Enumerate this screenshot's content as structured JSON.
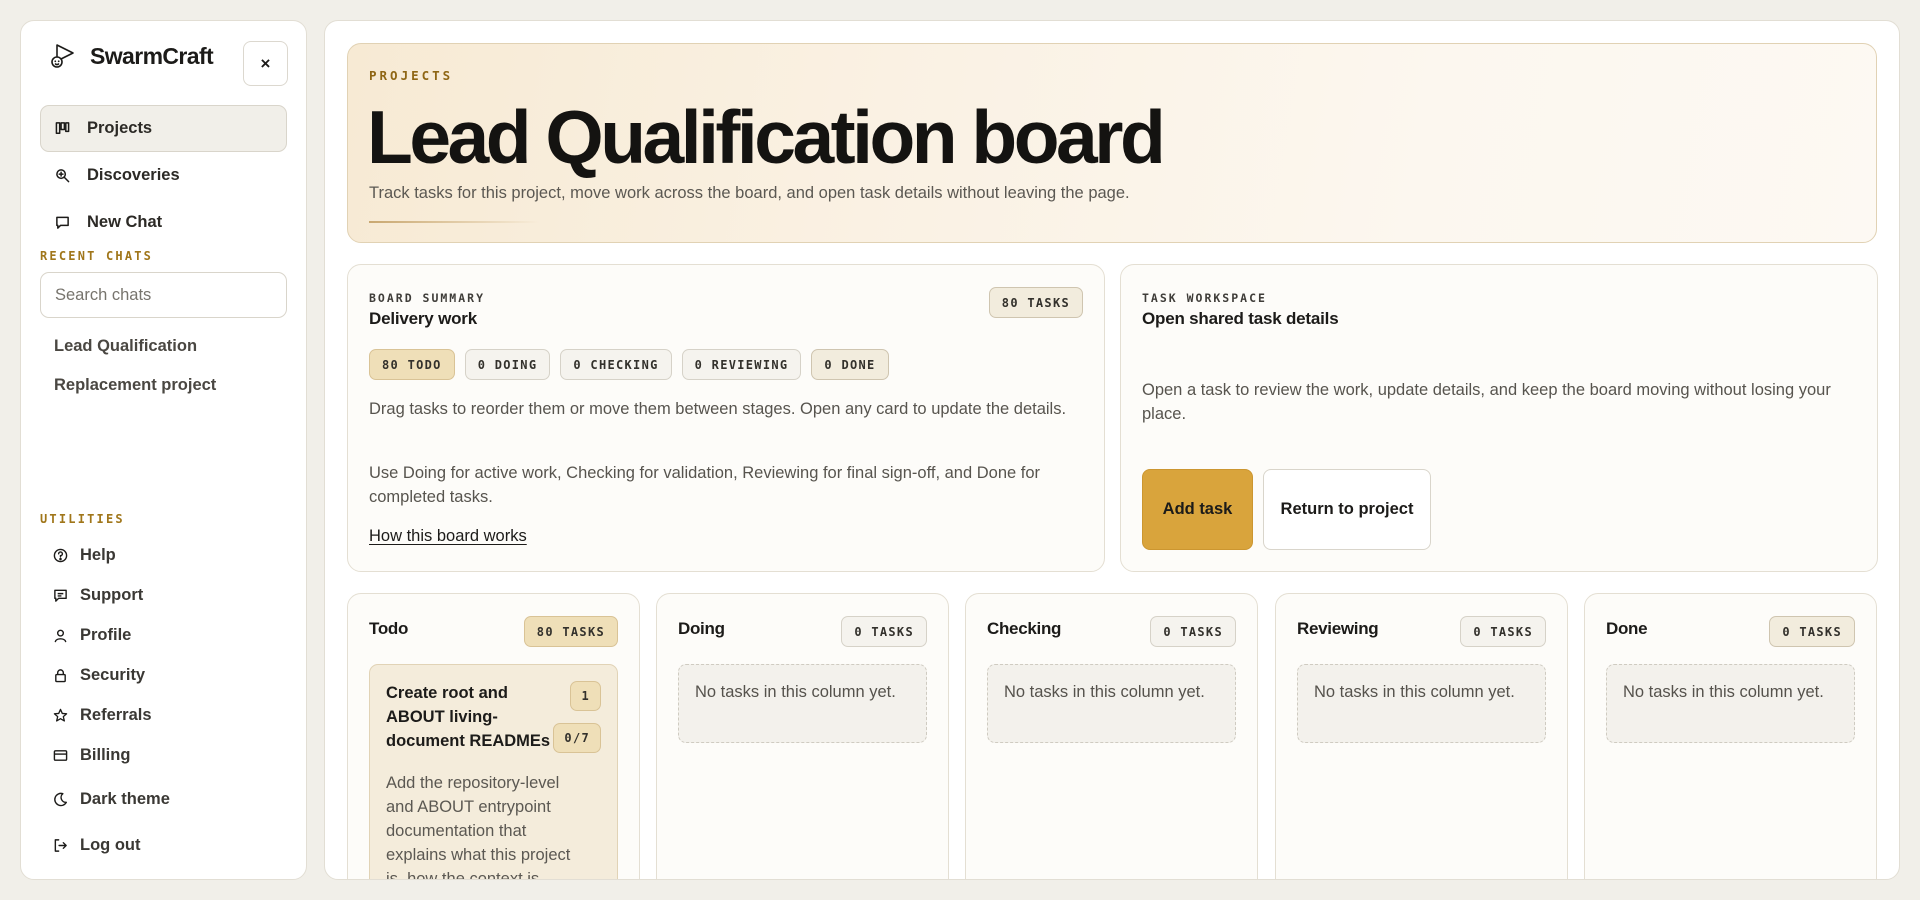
{
  "app": {
    "name": "SwarmCraft",
    "close_label": "×"
  },
  "nav": {
    "items": [
      {
        "label": "Projects",
        "icon": "board-icon"
      },
      {
        "label": "Discoveries",
        "icon": "magnifier-icon"
      },
      {
        "label": "New Chat",
        "icon": "chat-bubble-icon"
      }
    ]
  },
  "recent": {
    "label": "RECENT CHATS",
    "search_placeholder": "Search chats",
    "items": [
      "Lead Qualification",
      "Replacement project"
    ]
  },
  "utilities": {
    "label": "UTILITIES",
    "items": [
      {
        "label": "Help",
        "icon": "help-icon"
      },
      {
        "label": "Support",
        "icon": "message-icon"
      },
      {
        "label": "Profile",
        "icon": "user-icon"
      },
      {
        "label": "Security",
        "icon": "lock-icon"
      },
      {
        "label": "Referrals",
        "icon": "star-icon"
      },
      {
        "label": "Billing",
        "icon": "card-icon"
      },
      {
        "label": "Dark theme",
        "icon": "moon-icon"
      },
      {
        "label": "Log out",
        "icon": "logout-icon"
      }
    ]
  },
  "hero": {
    "eyebrow": "PROJECTS",
    "title": "Lead Qualification board",
    "subtitle": "Track tasks for this project, move work across the board, and open task details without leaving the page."
  },
  "summary": {
    "eyebrow": "BOARD SUMMARY",
    "title": "Delivery work",
    "total": "80 TASKS",
    "stage_pills": [
      "80 TODO",
      "0 DOING",
      "0 CHECKING",
      "0 REVIEWING",
      "0 DONE"
    ],
    "paragraph1": "Drag tasks to reorder them or move them between stages. Open any card to update the details.",
    "paragraph2": "Use Doing for active work, Checking for validation, Reviewing for final sign-off, and Done for completed tasks.",
    "link": "How this board works"
  },
  "workspace": {
    "eyebrow": "TASK WORKSPACE",
    "title": "Open shared task details",
    "description": "Open a task to review the work, update details, and keep the board moving without losing your place.",
    "primary_button": "Add task",
    "secondary_button": "Return to project"
  },
  "board": {
    "empty_text": "No tasks in this column yet.",
    "columns": [
      {
        "title": "Todo",
        "count": "80 TASKS"
      },
      {
        "title": "Doing",
        "count": "0 TASKS"
      },
      {
        "title": "Checking",
        "count": "0 TASKS"
      },
      {
        "title": "Reviewing",
        "count": "0 TASKS"
      },
      {
        "title": "Done",
        "count": "0 TASKS"
      }
    ],
    "todo_card": {
      "title": "Create root and ABOUT living-document READMEs",
      "number": "1",
      "progress": "0/7",
      "description": "Add the repository-level and ABOUT entrypoint documentation that explains what this project is, how the context is maintained, and"
    }
  },
  "colors": {
    "accent": "#d9a43c",
    "eyebrow": "#a0761a",
    "background": "#f1efe9"
  }
}
